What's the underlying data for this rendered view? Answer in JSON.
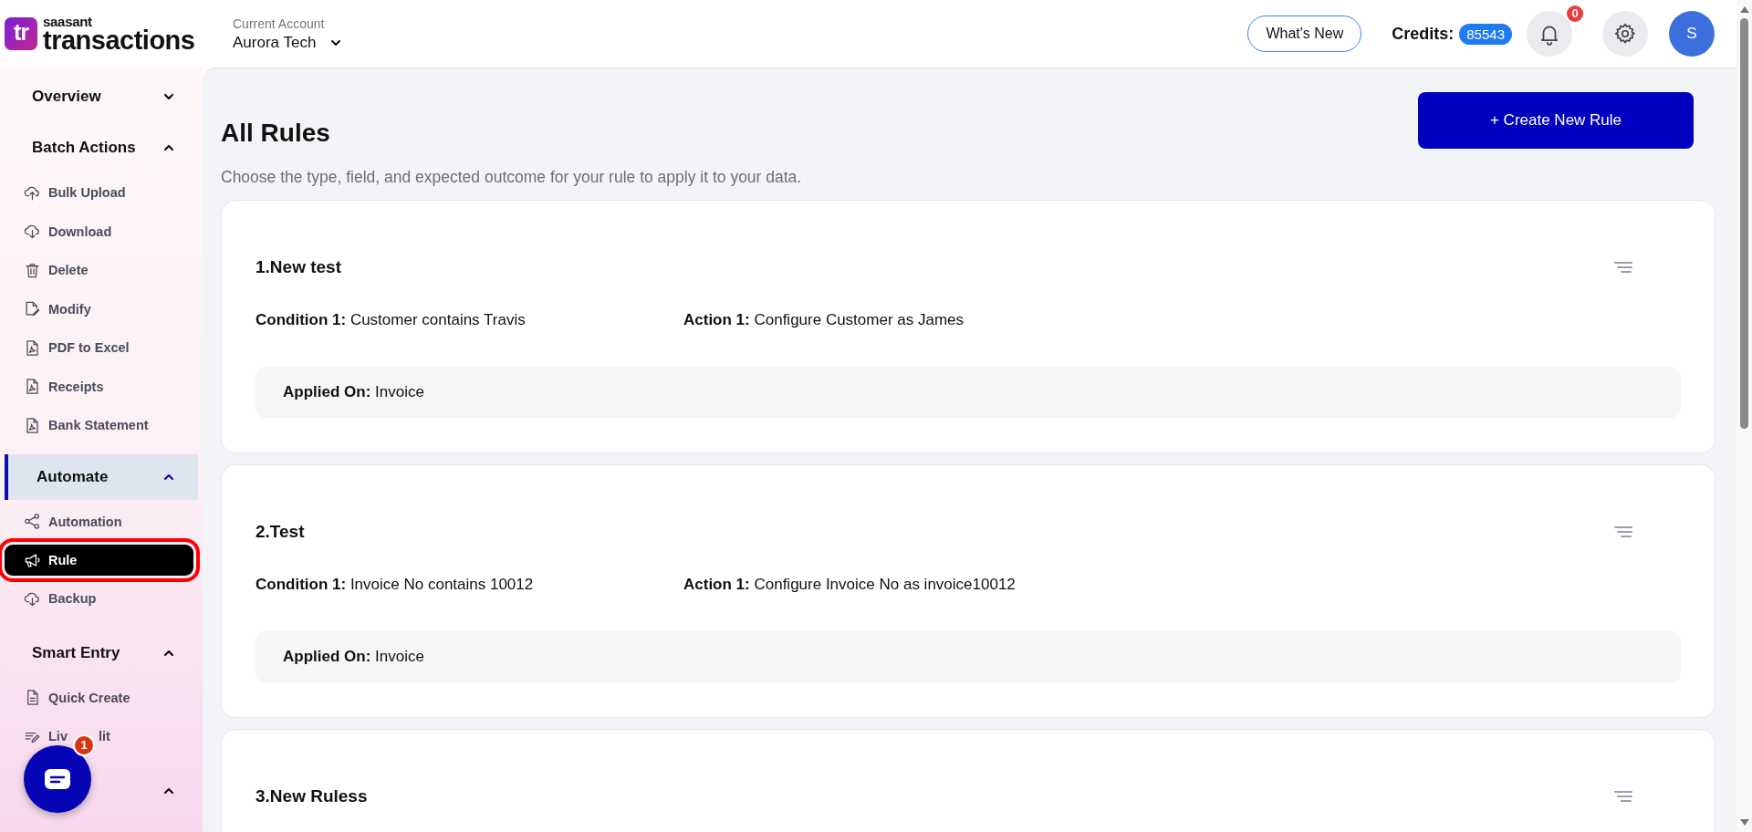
{
  "header": {
    "logo": {
      "mark": "tr",
      "brand": "saasant",
      "product": "transactions"
    },
    "account": {
      "label": "Current Account",
      "value": "Aurora Tech"
    },
    "whats_new": "What's New",
    "credits": {
      "label": "Credits:",
      "value": "85543"
    },
    "notifications": {
      "count": "0"
    },
    "avatar": "S"
  },
  "sidebar": {
    "sections": [
      {
        "label": "Overview",
        "expanded": false,
        "selected": false
      },
      {
        "label": "Batch Actions",
        "expanded": true,
        "selected": false,
        "items": [
          {
            "label": "Bulk Upload",
            "selected": false
          },
          {
            "label": "Download",
            "selected": false
          },
          {
            "label": "Delete",
            "selected": false
          },
          {
            "label": "Modify",
            "selected": false
          },
          {
            "label": "PDF to Excel",
            "selected": false
          },
          {
            "label": "Receipts",
            "selected": false
          },
          {
            "label": "Bank Statement",
            "selected": false
          }
        ]
      },
      {
        "label": "Automate",
        "expanded": true,
        "selected": true,
        "items": [
          {
            "label": "Automation",
            "selected": false
          },
          {
            "label": "Rule",
            "selected": true
          },
          {
            "label": "Backup",
            "selected": false
          }
        ]
      },
      {
        "label": "Smart Entry",
        "expanded": true,
        "selected": false,
        "items": [
          {
            "label": "Quick Create",
            "selected": false
          },
          {
            "label": "Liv",
            "label_end": "lit",
            "selected": false
          }
        ]
      },
      {
        "expanded": true
      }
    ]
  },
  "page": {
    "title": "All Rules",
    "subtitle": "Choose the type, field, and expected outcome for your rule to apply it to your data.",
    "create_button": "+ Create New Rule",
    "rules": [
      {
        "title": "1.New test",
        "condition": "**Condition 1:** Customer contains Travis",
        "action": "**Action 1:** Configure Customer as James",
        "applied": "**Applied On:** Invoice"
      },
      {
        "title": "2.Test",
        "condition": "**Condition 1:** Invoice No contains 10012",
        "action": "**Action 1:** Configure Invoice No as invoice10012",
        "applied": "**Applied On:** Invoice"
      },
      {
        "title": "3.New Ruless"
      }
    ]
  },
  "chat": {
    "badge": "1"
  }
}
